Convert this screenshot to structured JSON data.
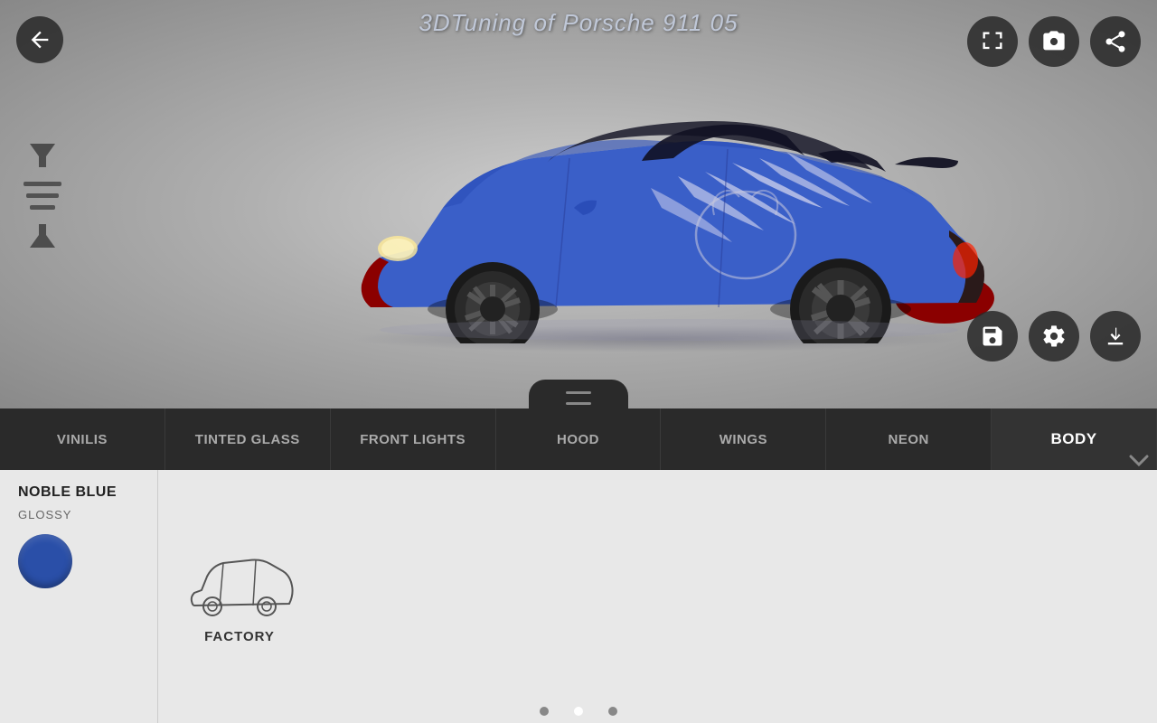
{
  "app": {
    "title": "3DTuning of Porsche 911 05"
  },
  "header": {
    "back_label": "back",
    "fullscreen_label": "fullscreen",
    "screenshot_label": "screenshot",
    "share_label": "share"
  },
  "toolbar_bottom_right": {
    "save_label": "save",
    "settings_label": "settings",
    "download_label": "download"
  },
  "nav_tabs": [
    {
      "id": "vinilis",
      "label": "VINILIS",
      "active": false
    },
    {
      "id": "tinted-glass",
      "label": "TINTED GLASS",
      "active": false
    },
    {
      "id": "front-lights",
      "label": "FRONT LIGHTS",
      "active": false
    },
    {
      "id": "hood",
      "label": "HOOD",
      "active": false
    },
    {
      "id": "wings",
      "label": "WINGS",
      "active": false
    },
    {
      "id": "neon",
      "label": "NEON",
      "active": false
    },
    {
      "id": "body",
      "label": "BODY",
      "active": true
    }
  ],
  "color_panel": {
    "color_name": "NOBLE BLUE",
    "finish_label": "GLOSSY",
    "swatch_color": "#2a4fa8"
  },
  "parts": [
    {
      "id": "factory",
      "label": "FACTORY"
    }
  ],
  "indicator_dots": [
    {
      "active": false
    },
    {
      "active": true
    },
    {
      "active": false
    }
  ],
  "drag_handle": {
    "aria": "drag handle"
  }
}
